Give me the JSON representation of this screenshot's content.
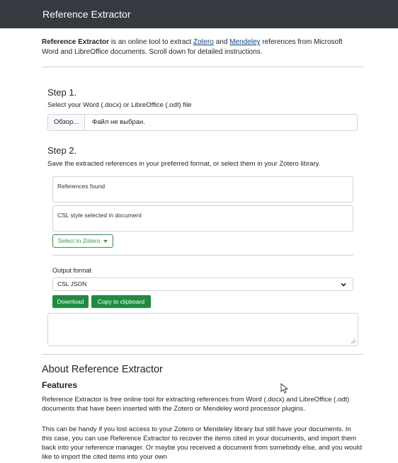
{
  "header": {
    "title": "Reference Extractor"
  },
  "intro": {
    "name": "Reference Extractor",
    "text_a": " is an online tool to extract ",
    "link_zotero": "Zotero",
    "text_and": " and ",
    "link_mendeley": "Mendeley",
    "text_b": " references from Microsoft Word and LibreOffice documents. Scroll down for detailed instructions."
  },
  "step1": {
    "title": "Step 1.",
    "desc": "Select your Word (.docx) or LibreOffice (.odt) file",
    "browse_label": "Обзор...",
    "file_status": "Файл не выбран."
  },
  "step2": {
    "title": "Step 2.",
    "desc": "Save the extracted references in your preferred format, or select them in your Zotero library.",
    "refs_found_label": "References found",
    "csl_label": "CSL style selected in document",
    "select_zotero_label": "Select in Zotero",
    "output_format_label": "Output format",
    "output_format_value": "CSL JSON",
    "download_label": "Download",
    "copy_label": "Copy to clipboard"
  },
  "about": {
    "title": "About Reference Extractor",
    "features_title": "Features",
    "para1": "Reference Extractor is free online tool for extracting references from Word (.docx) and LibreOffice (.odt) documents that have been inserted with the Zotero or Mendeley word processor plugins.",
    "para2": "This can be handy if you lost access to your Zotero or Mendeley library but still have your documents. In this case, you can use Reference Extractor to recover the items cited in your documents, and import them back into your reference manager. Or maybe you received a document from somebody else, and you would like to import the cited items into your own"
  },
  "colors": {
    "header_bg": "#343a40",
    "success": "#28a745",
    "link": "#0645ad"
  }
}
